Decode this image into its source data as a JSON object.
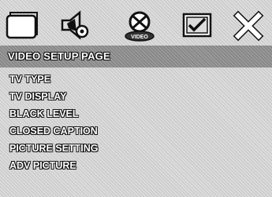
{
  "icons": [
    {
      "name": "general-setup-icon"
    },
    {
      "name": "audio-setup-icon"
    },
    {
      "name": "video-setup-icon"
    },
    {
      "name": "preference-setup-icon"
    },
    {
      "name": "exit-icon"
    }
  ],
  "header": {
    "title": "VIDEO SETUP PAGE"
  },
  "menu": {
    "items": [
      {
        "label": "TV TYPE"
      },
      {
        "label": "TV DISPLAY"
      },
      {
        "label": "BLACK LEVEL"
      },
      {
        "label": "CLOSED CAPTION"
      },
      {
        "label": "PICTURE SETTING"
      },
      {
        "label": "ADV PICTURE"
      }
    ]
  },
  "colors": {
    "background": "#dcdcdc",
    "header": "#9a9a9a",
    "text": "#ffffff",
    "outline": "#111111"
  }
}
